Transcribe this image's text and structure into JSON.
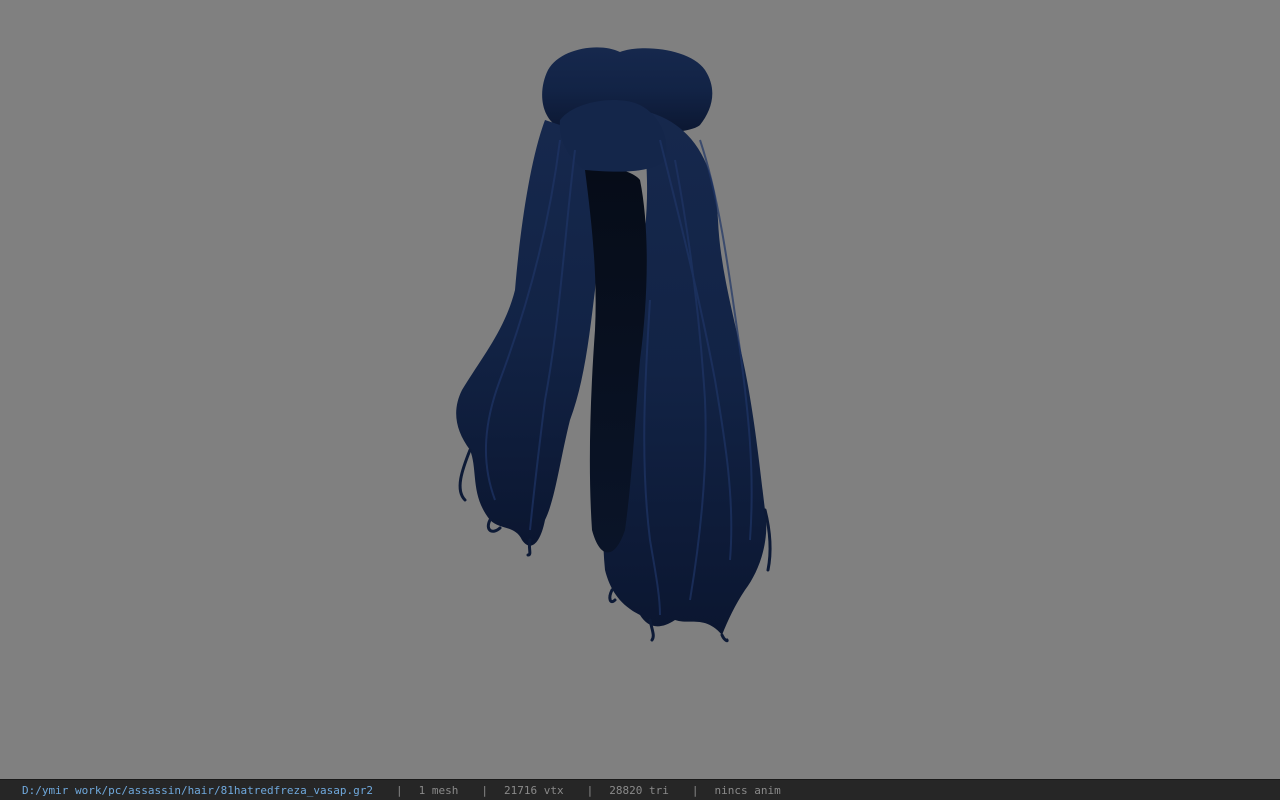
{
  "viewport": {
    "background_color": "#808080",
    "model": {
      "subject": "hair mesh",
      "tint_color": "#14264a",
      "shadow_color": "#08101f"
    }
  },
  "statusbar": {
    "file_path": "D:/ymir work/pc/assassin/hair/81hatredfreza_vasap.gr2",
    "separator": "|",
    "mesh_count": "1 mesh",
    "vertex_count": "21716 vtx",
    "triangle_count": "28820 tri",
    "animation": "nincs anim",
    "path_color": "#6fa8dc",
    "text_color": "#8a8a8a"
  }
}
